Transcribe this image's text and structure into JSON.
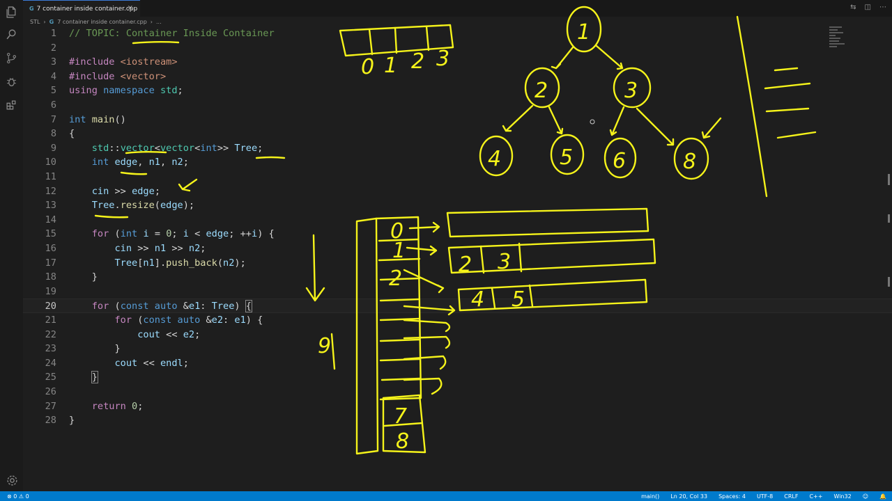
{
  "tab": {
    "title": "7 container inside container.cpp",
    "close": "×",
    "icon": "G"
  },
  "breadcrumb": {
    "folder": "STL",
    "sep": "›",
    "file": "7 container inside container.cpp",
    "tail": "..."
  },
  "activity_bar": [
    "files-icon",
    "search-icon",
    "source-control-icon",
    "debug-icon",
    "extensions-icon"
  ],
  "code_lines": [
    {
      "n": "1",
      "html": "<span class='c-com'>// TOPIC: Container Inside Container</span>"
    },
    {
      "n": "2",
      "html": ""
    },
    {
      "n": "3",
      "html": "<span class='c-pp'>#include</span> <span class='c-str'>&lt;iostream&gt;</span>"
    },
    {
      "n": "4",
      "html": "<span class='c-pp'>#include</span> <span class='c-str'>&lt;vector&gt;</span>"
    },
    {
      "n": "5",
      "html": "<span class='c-pp'>using</span> <span class='c-kw'>namespace</span> <span class='c-type'>std</span><span class='c-txt'>;</span>"
    },
    {
      "n": "6",
      "html": ""
    },
    {
      "n": "7",
      "html": "<span class='c-kw'>int</span> <span class='c-fn'>main</span><span class='c-txt'>()</span>"
    },
    {
      "n": "8",
      "html": "<span class='c-txt'>{</span>"
    },
    {
      "n": "9",
      "html": "    <span class='c-type'>std</span><span class='c-txt'>::</span><span class='c-type'>vector</span><span class='c-txt'>&lt;</span><span class='c-type'>vector</span><span class='c-txt'>&lt;</span><span class='c-kw'>int</span><span class='c-txt'>&gt;&gt;</span> <span class='c-var'>Tree</span><span class='c-txt'>;</span>"
    },
    {
      "n": "10",
      "html": "    <span class='c-kw'>int</span> <span class='c-var'>edge</span><span class='c-txt'>,</span> <span class='c-var'>n1</span><span class='c-txt'>,</span> <span class='c-var'>n2</span><span class='c-txt'>;</span>"
    },
    {
      "n": "11",
      "html": ""
    },
    {
      "n": "12",
      "html": "    <span class='c-var'>cin</span> <span class='c-txt'>&gt;&gt;</span> <span class='c-var'>edge</span><span class='c-txt'>;</span>"
    },
    {
      "n": "13",
      "html": "    <span class='c-var'>Tree</span><span class='c-txt'>.</span><span class='c-fn'>resize</span><span class='c-txt'>(</span><span class='c-var'>edge</span><span class='c-txt'>);</span>"
    },
    {
      "n": "14",
      "html": ""
    },
    {
      "n": "15",
      "html": "    <span class='c-pp'>for</span> <span class='c-txt'>(</span><span class='c-kw'>int</span> <span class='c-var'>i</span> <span class='c-txt'>=</span> <span class='c-num'>0</span><span class='c-txt'>;</span> <span class='c-var'>i</span> <span class='c-txt'>&lt;</span> <span class='c-var'>edge</span><span class='c-txt'>;</span> <span class='c-txt'>++</span><span class='c-var'>i</span><span class='c-txt'>) {</span>"
    },
    {
      "n": "16",
      "html": "        <span class='c-var'>cin</span> <span class='c-txt'>&gt;&gt;</span> <span class='c-var'>n1</span> <span class='c-txt'>&gt;&gt;</span> <span class='c-var'>n2</span><span class='c-txt'>;</span>"
    },
    {
      "n": "17",
      "html": "        <span class='c-var'>Tree</span><span class='c-txt'>[</span><span class='c-var'>n1</span><span class='c-txt'>].</span><span class='c-fn'>push_back</span><span class='c-txt'>(</span><span class='c-var'>n2</span><span class='c-txt'>);</span>"
    },
    {
      "n": "18",
      "html": "    <span class='c-txt'>}</span>"
    },
    {
      "n": "19",
      "html": ""
    },
    {
      "n": "20",
      "html": "    <span class='c-pp'>for</span> <span class='c-txt'>(</span><span class='c-kw'>const</span> <span class='c-kw'>auto</span> <span class='c-txt'>&amp;</span><span class='c-var'>e1</span><span class='c-txt'>:</span> <span class='c-var'>Tree</span><span class='c-txt'>) </span><span class='c-txt bracket-box'>{</span>"
    },
    {
      "n": "21",
      "html": "        <span class='c-pp'>for</span> <span class='c-txt'>(</span><span class='c-kw'>const</span> <span class='c-kw'>auto</span> <span class='c-txt'>&amp;</span><span class='c-var'>e2</span><span class='c-txt'>:</span> <span class='c-var'>e1</span><span class='c-txt'>) {</span>"
    },
    {
      "n": "22",
      "html": "            <span class='c-var'>cout</span> <span class='c-txt'>&lt;&lt;</span> <span class='c-var'>e2</span><span class='c-txt'>;</span>"
    },
    {
      "n": "23",
      "html": "        <span class='c-txt'>}</span>"
    },
    {
      "n": "24",
      "html": "        <span class='c-var'>cout</span> <span class='c-txt'>&lt;&lt;</span> <span class='c-var'>endl</span><span class='c-txt'>;</span>"
    },
    {
      "n": "25",
      "html": "    <span class='c-txt bracket-box'>}</span>"
    },
    {
      "n": "26",
      "html": ""
    },
    {
      "n": "27",
      "html": "    <span class='c-pp'>return</span> <span class='c-num'>0</span><span class='c-txt'>;</span>"
    },
    {
      "n": "28",
      "html": "<span class='c-txt'>}</span>"
    }
  ],
  "current_line": "20",
  "annotations": {
    "array_indices": [
      "0",
      "1",
      "2",
      "3"
    ],
    "tree_nodes": [
      "1",
      "2",
      "3",
      "4",
      "5",
      "6",
      "8"
    ],
    "container_indices": [
      "0",
      "1",
      "2",
      "7",
      "8"
    ],
    "row1_values": [
      "2",
      "3"
    ],
    "row2_values": [
      "4",
      "5"
    ],
    "count": "9"
  },
  "status": {
    "problems": "⊗ 0 ⚠ 0",
    "branch": "main()",
    "position": "Ln 20, Col 33",
    "spaces": "Spaces: 4",
    "encoding": "UTF-8",
    "eol": "CRLF",
    "language": "C++",
    "platform": "Win32"
  },
  "colors": {
    "status_bar": "#007acc",
    "ink": "#f5f31a",
    "editor_bg": "#1e1e1e"
  }
}
